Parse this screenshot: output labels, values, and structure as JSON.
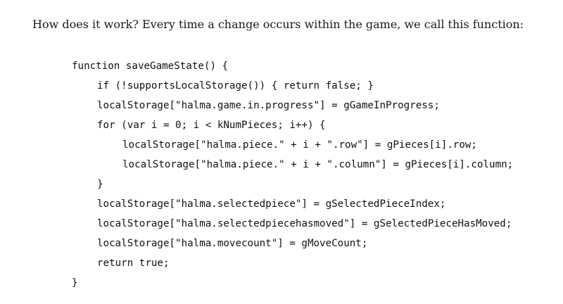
{
  "intro": "How does it work? Every time a change occurs within the game, we call this function:",
  "code": [
    {
      "indent": 0,
      "text": "function saveGameState() {"
    },
    {
      "indent": 1,
      "text": "if (!supportsLocalStorage()) { return false; }"
    },
    {
      "indent": 1,
      "text": "localStorage[\"halma.game.in.progress\"] = gGameInProgress;"
    },
    {
      "indent": 1,
      "text": "for (var i = 0; i < kNumPieces; i++) {"
    },
    {
      "indent": 2,
      "text": "localStorage[\"halma.piece.\" + i + \".row\"] = gPieces[i].row;"
    },
    {
      "indent": 2,
      "text": "localStorage[\"halma.piece.\" + i + \".column\"] = gPieces[i].column;"
    },
    {
      "indent": 1,
      "text": "}"
    },
    {
      "indent": 1,
      "text": "localStorage[\"halma.selectedpiece\"] = gSelectedPieceIndex;"
    },
    {
      "indent": 1,
      "text": "localStorage[\"halma.selectedpiecehasmoved\"] = gSelectedPieceHasMoved;"
    },
    {
      "indent": 1,
      "text": "localStorage[\"halma.movecount\"] = gMoveCount;"
    },
    {
      "indent": 1,
      "text": "return true;"
    },
    {
      "indent": 0,
      "text": "}"
    }
  ]
}
